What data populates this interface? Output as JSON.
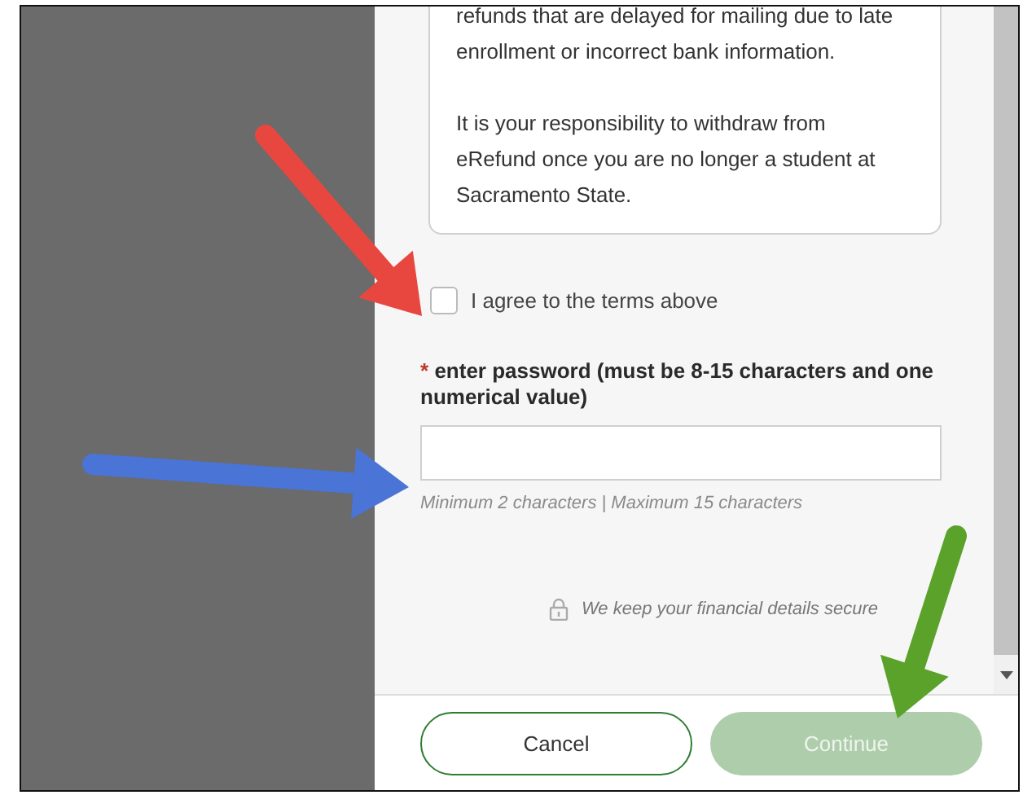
{
  "terms": {
    "paragraphs": [
      "refunds that are delayed for mailing due to late enrollment or incorrect bank information.",
      "It is your responsibility to withdraw from eRefund once you are no longer a student at Sacramento State."
    ]
  },
  "agree": {
    "label": "I agree to the terms above",
    "checked": false
  },
  "password": {
    "required_mark": "*",
    "label": "enter password (must be 8-15 characters and one numerical value)",
    "hint": "Minimum 2 characters | Maximum 15 characters"
  },
  "security_note": "We keep your financial details secure",
  "buttons": [
    {
      "label": "Cancel",
      "kind": "secondary",
      "disabled": false
    },
    {
      "label": "Continue",
      "kind": "primary",
      "disabled": true
    }
  ]
}
